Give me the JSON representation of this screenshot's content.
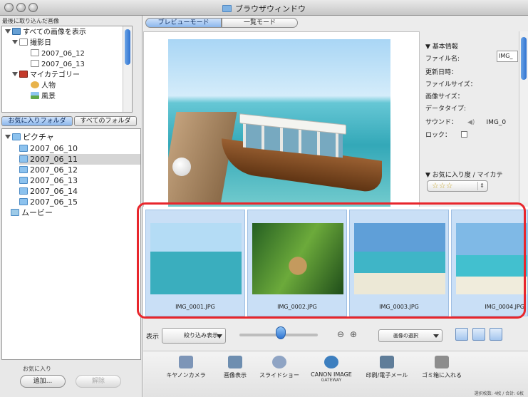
{
  "window": {
    "title": "ブラウザウィンドウ"
  },
  "left_panel": {
    "header": "最後に取り込んだ画像",
    "tree1": [
      {
        "label": "すべての画像を表示",
        "icon": "album-icon",
        "expanded": true
      },
      {
        "label": "撮影日",
        "icon": "calendar-icon",
        "expanded": true
      },
      {
        "label": "2007_06_12",
        "icon": "calendar-icon"
      },
      {
        "label": "2007_06_13",
        "icon": "calendar-icon"
      },
      {
        "label": "マイカテゴリー",
        "icon": "category-icon",
        "expanded": true
      },
      {
        "label": "人物",
        "icon": "person-icon"
      },
      {
        "label": "風景",
        "icon": "scenery-icon"
      }
    ],
    "tabs": {
      "favorite_folder": "お気に入りフォルダ",
      "all_folders": "すべてのフォルダ"
    },
    "tree2": [
      {
        "label": "ピクチャ",
        "icon": "pictures-folder-icon",
        "expanded": true
      },
      {
        "label": "2007_06_10",
        "icon": "folder-icon"
      },
      {
        "label": "2007_06_11",
        "icon": "folder-icon",
        "selected": true
      },
      {
        "label": "2007_06_12",
        "icon": "folder-icon"
      },
      {
        "label": "2007_06_13",
        "icon": "folder-icon"
      },
      {
        "label": "2007_06_14",
        "icon": "folder-icon"
      },
      {
        "label": "2007_06_15",
        "icon": "folder-icon"
      },
      {
        "label": "ムービー",
        "icon": "movie-folder-icon"
      }
    ],
    "favorites": {
      "label": "お気に入り",
      "add": "追加...",
      "remove": "解除"
    }
  },
  "mode_tabs": {
    "preview": "プレビューモード",
    "list": "一覧モード"
  },
  "info": {
    "section_basic": "▼ 基本情報",
    "filename_label": "ファイル名:",
    "filename_value": "IMG_",
    "modified_label": "更新日時：",
    "filesize_label": "ファイルサイズ：",
    "imagesize_label": "画像サイズ：",
    "datatype_label": "データタイプ:",
    "sound_label": "サウンド：",
    "sound_value": "IMG_0",
    "lock_label": "ロック：",
    "section_fav": "▼ お気に入り度 / マイカテ",
    "stars": "☆☆☆"
  },
  "thumbnails": [
    {
      "name": "IMG_0001.JPG"
    },
    {
      "name": "IMG_0002.JPG"
    },
    {
      "name": "IMG_0003.JPG"
    },
    {
      "name": "IMG_0004.JPG"
    }
  ],
  "toolbar": {
    "display_label": "表示",
    "filter_label": "絞り込み表示",
    "select_label": "画像の選択"
  },
  "actions": [
    {
      "label": "キヤノンカメラ",
      "icon": "camera-icon"
    },
    {
      "label": "画像表示",
      "icon": "image-view-icon"
    },
    {
      "label": "スライドショー",
      "icon": "slideshow-icon"
    },
    {
      "label": "CANON IMAGE",
      "sub": "GATEWAY",
      "icon": "gateway-icon"
    },
    {
      "label": "印刷/電子メール",
      "icon": "print-email-icon"
    },
    {
      "label": "ゴミ箱に入れる",
      "icon": "trash-icon"
    }
  ],
  "status": "選択枚数: 4枚 / 合計: 6枚",
  "colors": {
    "highlight": "#e8262c",
    "selection_blue": "#8cb7ec"
  }
}
